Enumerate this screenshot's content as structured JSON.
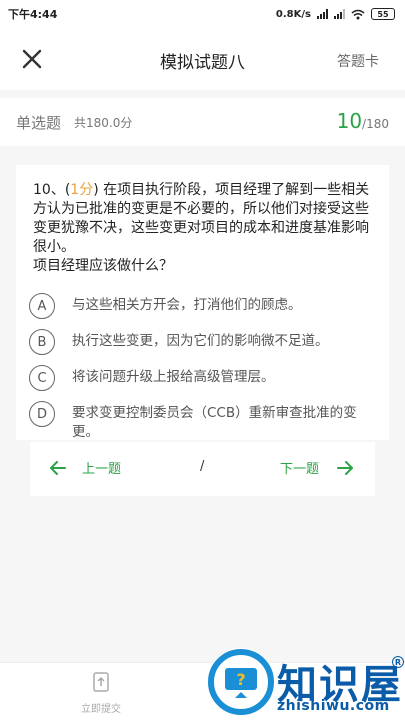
{
  "status_bar": {
    "time": "下午4:44",
    "network_speed": "0.8K/s",
    "battery": "55"
  },
  "header": {
    "title": "模拟试题八",
    "answer_card_label": "答题卡"
  },
  "section": {
    "type_label": "单选题",
    "score_label": "共180.0分",
    "current": "10",
    "total": "/180"
  },
  "question": {
    "number": "10、(",
    "points": "1分",
    "text_after_points": ") 在项目执行阶段，项目经理了解到一些相关方认为已批准的变更是不必要的，所以他们对接受这些变更犹豫不决，这些变更对项目的成本和进度基准影响很小。",
    "prompt": "项目经理应该做什么？",
    "options": [
      {
        "letter": "A",
        "text": "与这些相关方开会，打消他们的顾虑。"
      },
      {
        "letter": "B",
        "text": "执行这些变更，因为它们的影响微不足道。"
      },
      {
        "letter": "C",
        "text": "将该问题升级上报给高级管理层。"
      },
      {
        "letter": "D",
        "text": "要求变更控制委员会（CCB）重新审查批准的变更。"
      }
    ]
  },
  "navigation": {
    "prev_label": "上一题",
    "separator": "/",
    "next_label": "下一题"
  },
  "bottom": {
    "submit_label": "立即提交"
  },
  "watermark": {
    "brand": "知识屋",
    "url": "zhishiwu.com",
    "registered": "R"
  },
  "colors": {
    "accent": "#2ba245",
    "points": "#e9a33a",
    "brand": "#0a5ca8"
  }
}
